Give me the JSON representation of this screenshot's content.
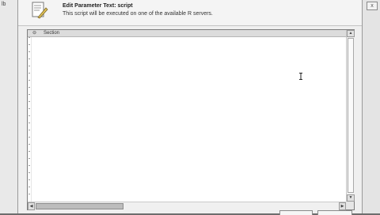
{
  "background": {
    "left_window_text": "lb",
    "right_window_close": "x"
  },
  "dialog": {
    "title_prefix": "Edit Parameter Text: ",
    "title_param": "script",
    "subtitle": "This script will be executed on one of the available R servers.",
    "icon": "edit-document-icon"
  },
  "editor": {
    "fold_marker": "⊖",
    "fold_label": "Section",
    "content": ""
  },
  "colors": {
    "dialog_bg": "#efefef",
    "editor_bg": "#ffffff",
    "backdrop": "#6d6d6d"
  }
}
